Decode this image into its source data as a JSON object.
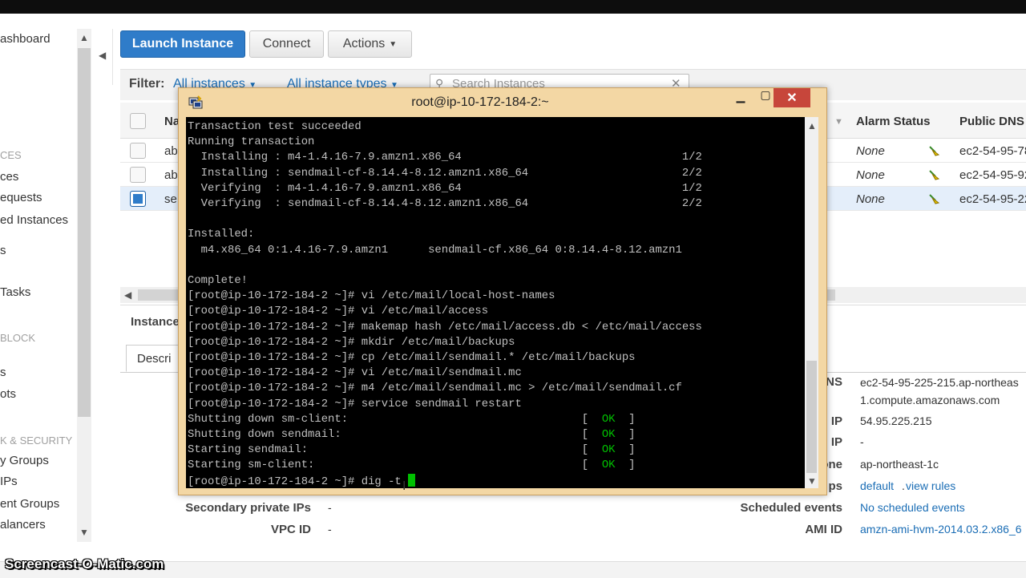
{
  "sidebar": {
    "items": [
      "ashboard",
      "CES",
      "ces",
      "equests",
      "ed Instances",
      "s",
      "Tasks",
      "BLOCK",
      "s",
      "ots",
      "K & SECURITY",
      "y Groups",
      "IPs",
      "ent Groups",
      "alancers"
    ]
  },
  "toolbar": {
    "launch_label": "Launch Instance",
    "connect_label": "Connect",
    "actions_label": "Actions"
  },
  "filter": {
    "label": "Filter:",
    "instances": "All instances",
    "types": "All instance types",
    "search_placeholder": "Search Instances"
  },
  "table": {
    "headers": {
      "name": "Na",
      "alarm": "Alarm Status",
      "dns": "Public DNS"
    },
    "rows": [
      {
        "name": "ab",
        "alarm": "None",
        "dns": "ec2-54-95-78",
        "selected": false
      },
      {
        "name": "ab",
        "alarm": "None",
        "dns": "ec2-54-95-92",
        "selected": false
      },
      {
        "name": "se",
        "alarm": "None",
        "dns": "ec2-54-95-22",
        "selected": true
      }
    ]
  },
  "details": {
    "header": "Instance",
    "tab": "Descri",
    "right": [
      {
        "label": "NS",
        "value": "ec2-54-95-225-215.ap-northeas",
        "value2": "1.compute.amazonaws.com"
      },
      {
        "label": "IP",
        "value": "54.95.225.215"
      },
      {
        "label": "IP",
        "value": "-"
      },
      {
        "label": "one",
        "value": "ap-northeast-1c"
      },
      {
        "label": "ps",
        "value": "default",
        "value_b": "view rules"
      },
      {
        "label": "Scheduled events",
        "value": "No scheduled events"
      },
      {
        "label": "AMI ID",
        "value": "amzn-ami-hvm-2014.03.2.x86_6"
      }
    ],
    "left": [
      {
        "label": "Secondary private IPs",
        "value": "-"
      },
      {
        "label": "VPC ID",
        "value": "-"
      }
    ]
  },
  "terminal": {
    "title": "root@ip-10-172-184-2:~",
    "lines": [
      "Transaction test succeeded",
      "Running transaction",
      "  Installing : m4-1.4.16-7.9.amzn1.x86_64                                 1/2",
      "  Installing : sendmail-cf-8.14.4-8.12.amzn1.x86_64                       2/2",
      "  Verifying  : m4-1.4.16-7.9.amzn1.x86_64                                 1/2",
      "  Verifying  : sendmail-cf-8.14.4-8.12.amzn1.x86_64                       2/2",
      "",
      "Installed:",
      "  m4.x86_64 0:1.4.16-7.9.amzn1      sendmail-cf.x86_64 0:8.14.4-8.12.amzn1",
      "",
      "Complete!",
      "[root@ip-10-172-184-2 ~]# vi /etc/mail/local-host-names",
      "[root@ip-10-172-184-2 ~]# vi /etc/mail/access",
      "[root@ip-10-172-184-2 ~]# makemap hash /etc/mail/access.db < /etc/mail/access",
      "[root@ip-10-172-184-2 ~]# mkdir /etc/mail/backups",
      "[root@ip-10-172-184-2 ~]# cp /etc/mail/sendmail.* /etc/mail/backups",
      "[root@ip-10-172-184-2 ~]# vi /etc/mail/sendmail.mc",
      "[root@ip-10-172-184-2 ~]# m4 /etc/mail/sendmail.mc > /etc/mail/sendmail.cf",
      "[root@ip-10-172-184-2 ~]# service sendmail restart"
    ],
    "status_lines": [
      {
        "text": "Shutting down sm-client:",
        "status": "OK"
      },
      {
        "text": "Shutting down sendmail:",
        "status": "OK"
      },
      {
        "text": "Starting sendmail:",
        "status": "OK"
      },
      {
        "text": "Starting sm-client:",
        "status": "OK"
      }
    ],
    "prompt": "[root@ip-10-172-184-2 ~]# ",
    "input": "dig -t "
  },
  "watermark": "Screencast-O-Matic.com",
  "colors": {
    "accent": "#2f7cc9",
    "link": "#1a6db5",
    "terminal_ok": "#00c000",
    "close": "#c7463b"
  }
}
